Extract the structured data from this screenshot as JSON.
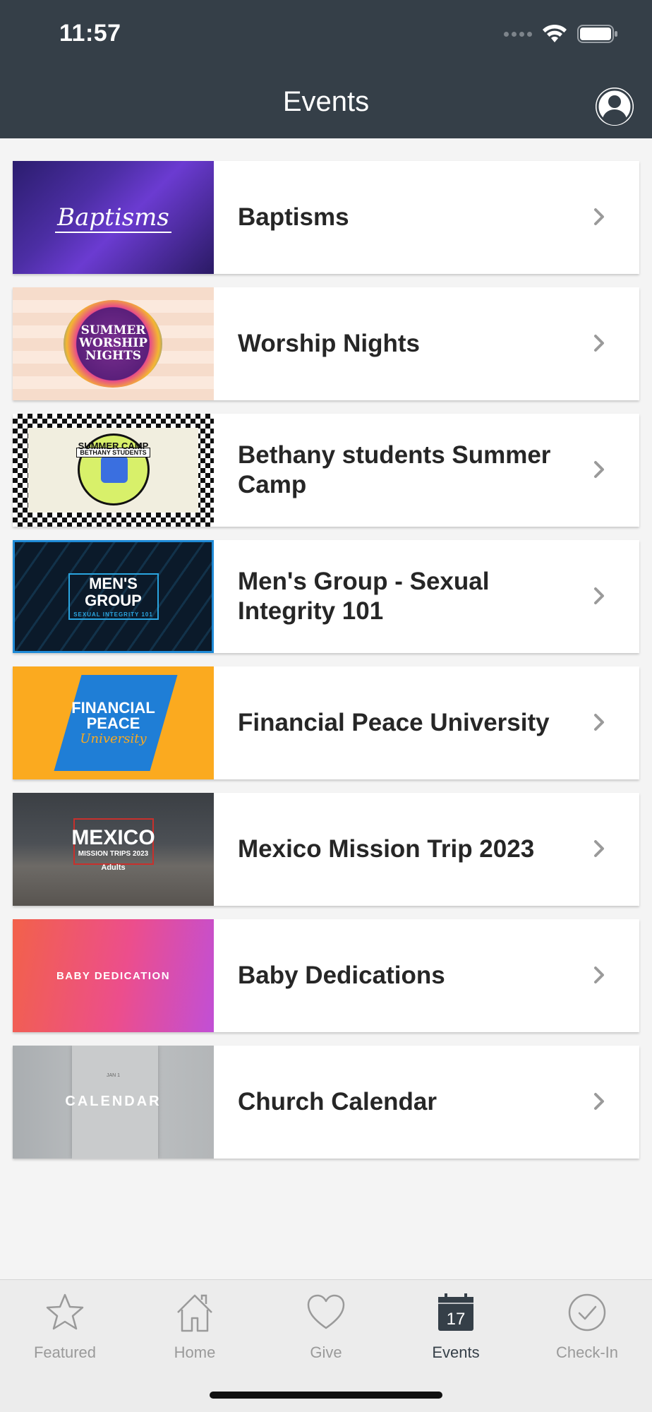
{
  "status_bar": {
    "time": "11:57"
  },
  "header": {
    "title": "Events"
  },
  "events": [
    {
      "title": "Baptisms",
      "thumb_text": "Baptisms"
    },
    {
      "title": "Worship Nights",
      "thumb_text": "SUMMER WORSHIP NIGHTS"
    },
    {
      "title": "Bethany students Summer Camp",
      "thumb_text": "SUMMER CAMP",
      "thumb_subtext": "BETHANY STUDENTS"
    },
    {
      "title": "Men's Group - Sexual Integrity 101",
      "thumb_text": "MEN'S GROUP",
      "thumb_subtext": "SEXUAL INTEGRITY 101"
    },
    {
      "title": "Financial Peace University",
      "thumb_text": "FINANCIAL PEACE",
      "thumb_subtext": "University"
    },
    {
      "title": "Mexico Mission Trip 2023",
      "thumb_text": "MEXICO",
      "thumb_subtext": "MISSION TRIPS 2023",
      "thumb_subtext2": "Adults"
    },
    {
      "title": "Baby Dedications",
      "thumb_text": "BABY DEDICATION"
    },
    {
      "title": "Church Calendar",
      "thumb_text": "CALENDAR",
      "thumb_subtext": "JAN 1"
    }
  ],
  "tabbar": {
    "tabs": [
      {
        "label": "Featured",
        "icon": "star-icon"
      },
      {
        "label": "Home",
        "icon": "home-icon"
      },
      {
        "label": "Give",
        "icon": "heart-icon"
      },
      {
        "label": "Events",
        "icon": "calendar-icon",
        "badge": "17",
        "active": true
      },
      {
        "label": "Check-In",
        "icon": "check-circle-icon"
      }
    ]
  },
  "colors": {
    "header": "#353f48",
    "background": "#f4f4f4",
    "tab_inactive": "#9a9a9a",
    "tab_active": "#353f48"
  }
}
